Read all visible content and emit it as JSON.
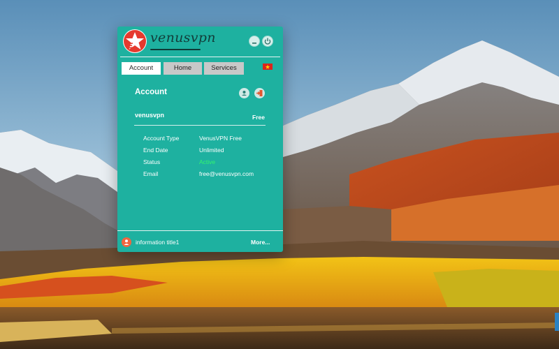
{
  "app": {
    "logo_text": "venusvpn",
    "tabs": [
      {
        "label": "Account",
        "active": true
      },
      {
        "label": "Home",
        "active": false
      },
      {
        "label": "Services",
        "active": false
      }
    ],
    "language_flag": "vietnam-flag-icon"
  },
  "account": {
    "title": "Account",
    "username": "venusvpn",
    "plan": "Free",
    "rows": [
      {
        "label": "Account Type",
        "value": "VenusVPN Free"
      },
      {
        "label": "End Date",
        "value": "Unlimited"
      },
      {
        "label": "Status",
        "value": "Active"
      },
      {
        "label": "Email",
        "value": "free@venusvpn.com"
      }
    ]
  },
  "footer": {
    "info_title": "information title1",
    "more_label": "More..."
  },
  "colors": {
    "app_background": "#1eb1a0",
    "status_active": "#33f56f",
    "tab_inactive": "#c8c8c8",
    "info_icon": "#f0653f",
    "logo_red": "#e53a2e"
  }
}
